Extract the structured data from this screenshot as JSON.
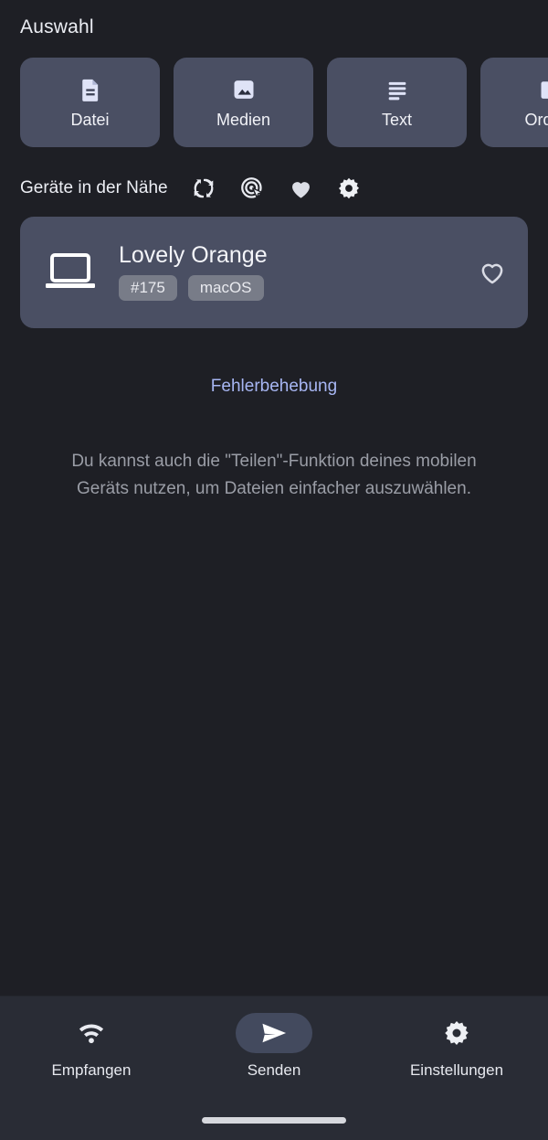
{
  "selection": {
    "title": "Auswahl",
    "chips": [
      {
        "label": "Datei",
        "icon": "file-icon"
      },
      {
        "label": "Medien",
        "icon": "image-icon"
      },
      {
        "label": "Text",
        "icon": "text-lines-icon"
      },
      {
        "label": "Ordner",
        "icon": "folder-icon"
      }
    ]
  },
  "nearby": {
    "title": "Geräte in der Nähe",
    "actions": [
      {
        "name": "refresh-icon"
      },
      {
        "name": "scan-devices-icon"
      },
      {
        "name": "favorites-heart-icon"
      },
      {
        "name": "settings-gear-icon"
      }
    ],
    "devices": [
      {
        "name": "Lovely Orange",
        "device_icon": "laptop-icon",
        "badges": [
          "#175",
          "macOS"
        ],
        "favorite": false
      }
    ]
  },
  "troubleshoot": {
    "link_label": "Fehlerbehebung"
  },
  "hint": {
    "text": "Du kannst auch die \"Teilen\"-Funktion deines mobilen Geräts nutzen, um Dateien einfacher auszuwählen."
  },
  "bottom_nav": {
    "items": [
      {
        "label": "Empfangen",
        "icon": "wifi-icon",
        "active": false
      },
      {
        "label": "Senden",
        "icon": "send-plane-icon",
        "active": true
      },
      {
        "label": "Einstellungen",
        "icon": "settings-gear-icon",
        "active": false
      }
    ]
  },
  "colors": {
    "background": "#1e1f25",
    "surface": "#4a4f63",
    "bottom_bar": "#292c35",
    "badge": "#787c88",
    "link": "#a7b6f3",
    "muted_text": "#9a9da6",
    "primary_text": "#f1f2f7",
    "active_pill": "#434a5e"
  }
}
